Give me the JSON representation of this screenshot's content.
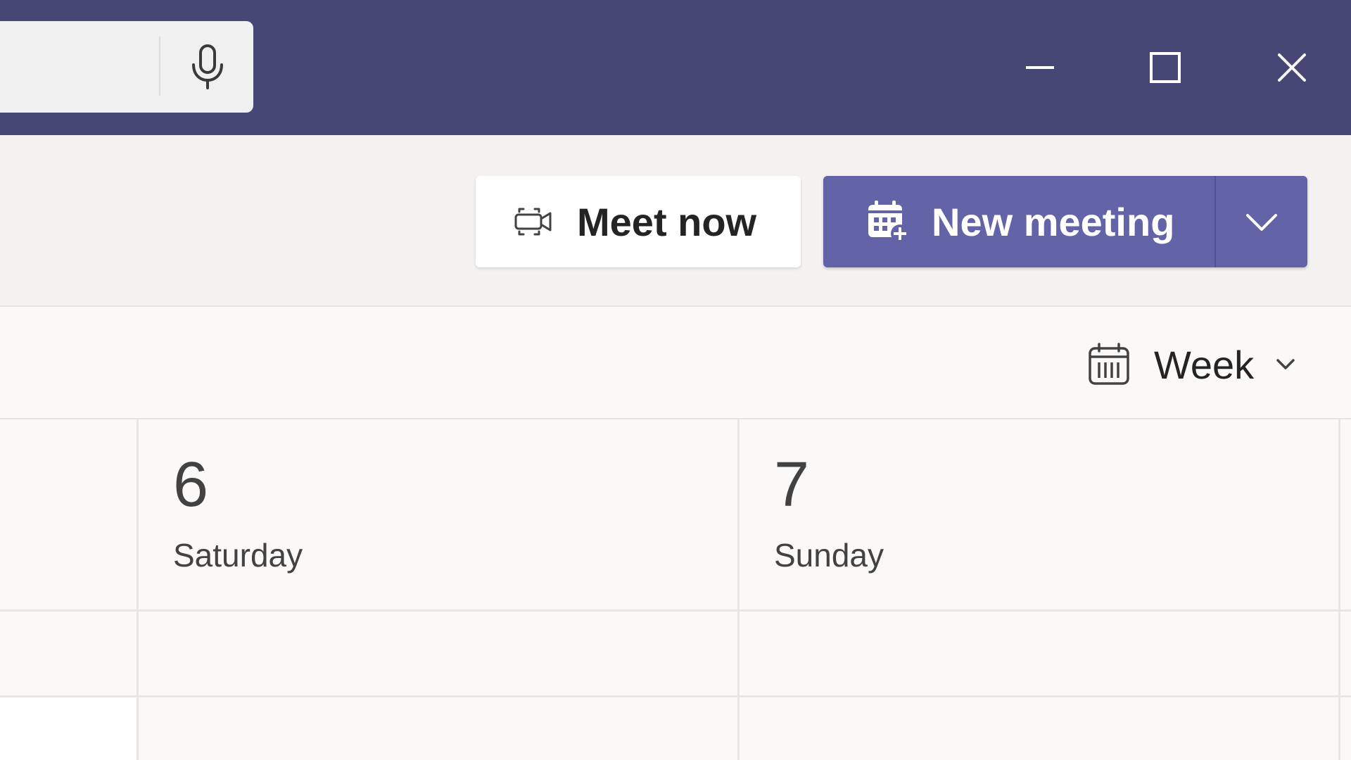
{
  "titlebar": {
    "background_color": "#464775",
    "search": {
      "placeholder": "",
      "mic_icon": "microphone-icon"
    },
    "window_controls": {
      "minimize_icon": "minimize-icon",
      "maximize_icon": "maximize-icon",
      "close_icon": "close-icon"
    }
  },
  "commandbar": {
    "meet_now": {
      "label": "Meet now",
      "icon": "video-camera-icon"
    },
    "new_meeting": {
      "label": "New meeting",
      "icon": "calendar-add-icon",
      "dropdown_icon": "chevron-down-icon",
      "color": "#6264a7"
    }
  },
  "viewbar": {
    "view_selector": {
      "label": "Week",
      "icon": "calendar-icon",
      "dropdown_icon": "chevron-down-icon"
    }
  },
  "calendar": {
    "days": [
      {
        "number": "6",
        "name": "Saturday"
      },
      {
        "number": "7",
        "name": "Sunday"
      }
    ]
  }
}
